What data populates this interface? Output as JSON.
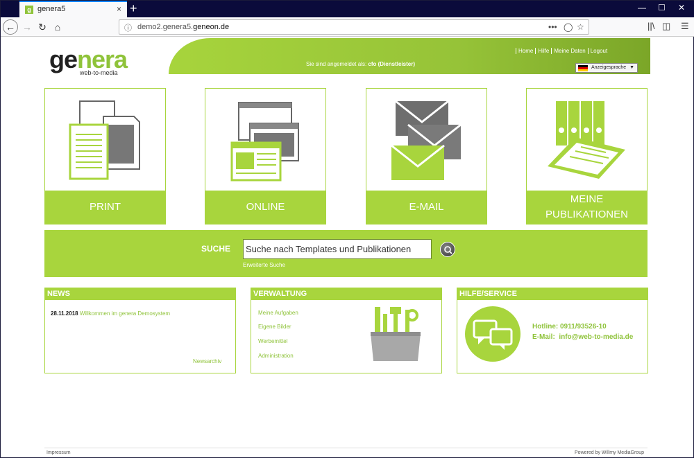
{
  "browser": {
    "tab_title": "genera5",
    "tab_close": "×",
    "new_tab": "+",
    "url_prefix": "demo2.genera5.",
    "url_domain": "geneon.de",
    "url_more": "•••"
  },
  "header": {
    "logo_ge": "ge",
    "logo_nera": "nera",
    "logo_sub": "web-to-media",
    "login_prefix": "Sie sind angemeldet als:",
    "login_user": "cfo (Dienstleister)",
    "links": [
      "Home",
      "Hilfe",
      "Meine Daten",
      "Logout"
    ],
    "language_label": "Anzeigesprache"
  },
  "tiles": [
    {
      "label": "PRINT"
    },
    {
      "label": "ONLINE"
    },
    {
      "label": "E-MAIL"
    },
    {
      "label": "MEINE PUBLIKATIONEN"
    }
  ],
  "search": {
    "label": "SUCHE",
    "placeholder": "Suche nach Templates und Publikationen",
    "advanced": "Erweiterte Suche"
  },
  "news": {
    "title": "NEWS",
    "date": "28.11.2018",
    "text": "Willkommen im genera Demosystem",
    "archive": "Newsarchiv"
  },
  "verwaltung": {
    "title": "VERWALTUNG",
    "links": [
      "Meine Aufgaben",
      "Eigene Bilder",
      "Werbemittel",
      "Administration"
    ]
  },
  "hilfe": {
    "title": "HILFE/SERVICE",
    "hotline_label": "Hotline:",
    "hotline": "0911/93526-10",
    "email_label": "E-Mail:",
    "email": "info@web-to-media.de"
  },
  "footer": {
    "impressum": "Impressum",
    "powered": "Powered by Willmy MediaGroup"
  },
  "colors": {
    "accent": "#a8d53d",
    "dark_accent": "#7ba628",
    "browser_frame": "#0b0b3b"
  }
}
